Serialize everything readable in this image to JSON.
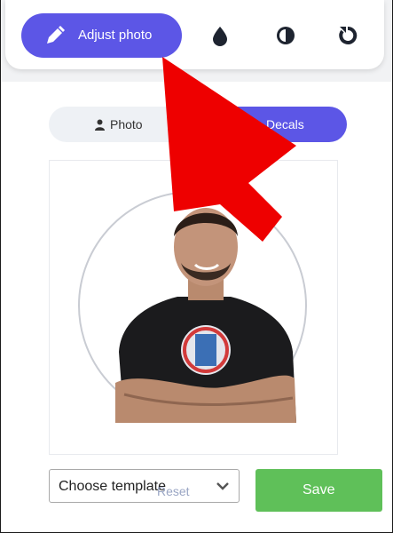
{
  "toolbar": {
    "adjust_label": "Adjust photo",
    "icons": [
      "pencil-icon",
      "drop-icon",
      "contrast-icon",
      "rotate-icon"
    ]
  },
  "tabs": {
    "photo_label": "Photo",
    "decals_label": "Decals",
    "active": "decals"
  },
  "template_select": {
    "value": "Choose template"
  },
  "actions": {
    "reset_label": "Reset",
    "save_label": "Save"
  },
  "colors": {
    "accent": "#5c56e6",
    "save": "#5fc059",
    "annotation_arrow": "#ee0000"
  }
}
